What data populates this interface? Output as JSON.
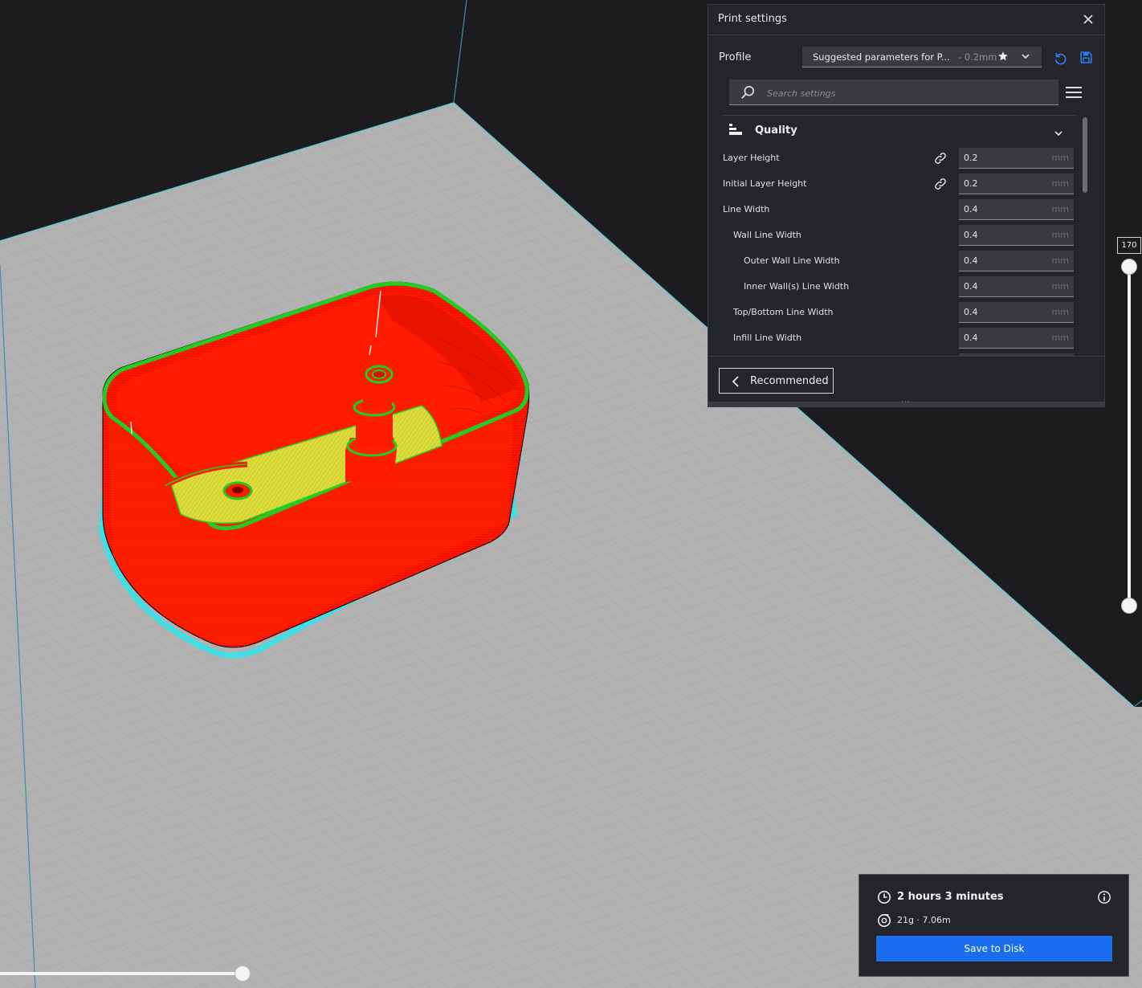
{
  "colors": {
    "background": "#1c1c1f",
    "build_plate": "#b3b3b3",
    "outer_wall": "#ff1a00",
    "inner_wall": "#33dd22",
    "top_bottom": "#d8d83a",
    "skirt": "#3ee0e6",
    "accent": "#196ef0",
    "panel": "#24252a"
  },
  "print_settings": {
    "title": "Print settings",
    "close_icon": "close-icon",
    "profile_label": "Profile",
    "profile_name": "Suggested parameters for P...",
    "profile_layer": "- 0.2mm",
    "search_placeholder": "Search settings",
    "category": "Quality",
    "settings": [
      {
        "label": "Layer Height",
        "value": "0.2",
        "unit": "mm",
        "linked": true,
        "indent": 0
      },
      {
        "label": "Initial Layer Height",
        "value": "0.2",
        "unit": "mm",
        "linked": true,
        "indent": 0
      },
      {
        "label": "Line Width",
        "value": "0.4",
        "unit": "mm",
        "linked": false,
        "indent": 0
      },
      {
        "label": "Wall Line Width",
        "value": "0.4",
        "unit": "mm",
        "linked": false,
        "indent": 1
      },
      {
        "label": "Outer Wall Line Width",
        "value": "0.4",
        "unit": "mm",
        "linked": false,
        "indent": 2
      },
      {
        "label": "Inner Wall(s) Line Width",
        "value": "0.4",
        "unit": "mm",
        "linked": false,
        "indent": 2
      },
      {
        "label": "Top/Bottom Line Width",
        "value": "0.4",
        "unit": "mm",
        "linked": false,
        "indent": 1
      },
      {
        "label": "Infill Line Width",
        "value": "0.4",
        "unit": "mm",
        "linked": false,
        "indent": 1
      }
    ],
    "recommended_label": "Recommended"
  },
  "layer_slider": {
    "current": "170",
    "upper_fraction": 1.0,
    "lower_fraction": 0.0
  },
  "horizontal_slider": {
    "fraction": 1.0
  },
  "output": {
    "time": "2 hours 3 minutes",
    "material": "21g · 7.06m",
    "save_label": "Save to Disk"
  }
}
